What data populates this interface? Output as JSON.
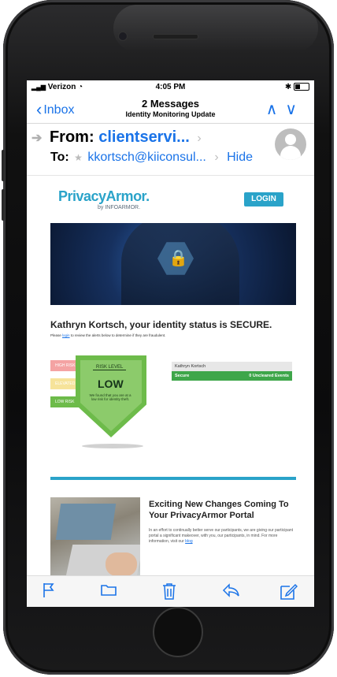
{
  "status_bar": {
    "carrier": "Verizon",
    "time": "4:05 PM"
  },
  "nav": {
    "back_label": "Inbox",
    "title": "2 Messages",
    "subtitle": "Identity Monitoring Update"
  },
  "header": {
    "from_label": "From:",
    "from_address": "clientservi...",
    "to_label": "To:",
    "to_address": "kkortsch@kiiconsul...",
    "hide_label": "Hide"
  },
  "email": {
    "brand": "PrivacyArmor.",
    "brand_by": "by INFOARMOR.",
    "login_label": "LOGIN",
    "status_title": "Kathryn Kortsch, your identity status is SECURE.",
    "status_note_pre": "Please",
    "status_note_link": "login",
    "status_note_post": "to review the alerts below to determine if they are fraudulent.",
    "risk_tabs": [
      "HIGH RISK",
      "ELEVATED RISK",
      "LOW RISK"
    ],
    "risk_tab_colors": [
      "#f4a3a3",
      "#f6e39a",
      "#6dbb4a"
    ],
    "risk_level_label": "RISK LEVEL",
    "risk_level_value": "LOW",
    "risk_desc": "We found that you are at a low risk for identity theft.",
    "info_name": "Kathryn Kortsch",
    "info_status": "Secure",
    "info_events": "0 Uncleared Events",
    "news_title": "Exciting New Changes Coming To Your PrivacyArmor Portal",
    "news_body": "In an effort to continually better serve our participants, we are giving our participant portal a significant makeover, with you, our participants, in mind. For more information, visit our",
    "news_link": "blog"
  },
  "toolbar": [
    "flag-icon",
    "folder-icon",
    "trash-icon",
    "reply-icon",
    "compose-icon"
  ],
  "colors": {
    "accent": "#1a73e8",
    "brand": "#2aa3c9",
    "secure_green": "#3ea64a"
  }
}
